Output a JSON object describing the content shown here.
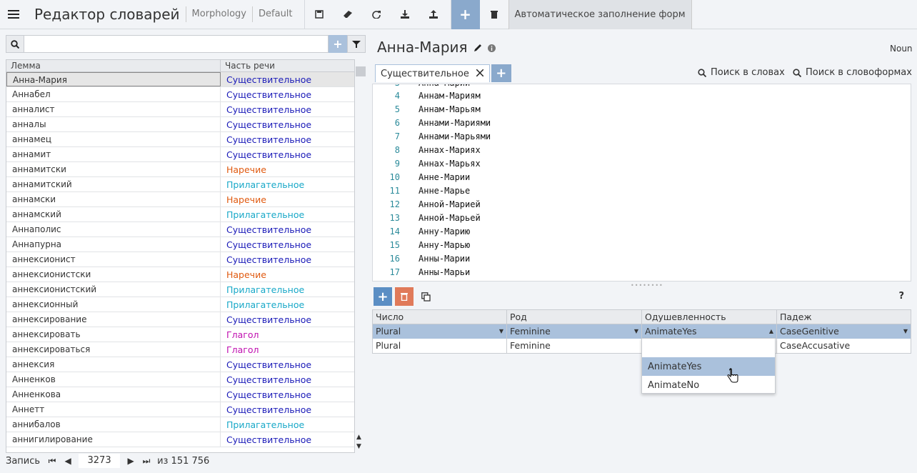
{
  "toolbar": {
    "title": "Редактор словарей",
    "link1": "Morphology",
    "link2": "Default",
    "autofill": "Автоматическое заполнение форм",
    "icons": [
      "menu-icon",
      "save-icon",
      "eraser-icon",
      "refresh-icon",
      "download-icon",
      "upload-icon",
      "plus-icon",
      "trash-icon"
    ]
  },
  "search": {
    "value": "",
    "placeholder": ""
  },
  "lemma_table": {
    "headers": [
      "Лемма",
      "Часть речи"
    ],
    "rows": [
      {
        "lemma": "Анна-Мария",
        "pos": "Существительное",
        "type": "noun"
      },
      {
        "lemma": "Аннабел",
        "pos": "Существительное",
        "type": "noun"
      },
      {
        "lemma": "анналист",
        "pos": "Существительное",
        "type": "noun"
      },
      {
        "lemma": "анналы",
        "pos": "Существительное",
        "type": "noun"
      },
      {
        "lemma": "аннамец",
        "pos": "Существительное",
        "type": "noun"
      },
      {
        "lemma": "аннамит",
        "pos": "Существительное",
        "type": "noun"
      },
      {
        "lemma": "аннамитски",
        "pos": "Наречие",
        "type": "adv"
      },
      {
        "lemma": "аннамитский",
        "pos": "Прилагательное",
        "type": "adj"
      },
      {
        "lemma": "аннамски",
        "pos": "Наречие",
        "type": "adv"
      },
      {
        "lemma": "аннамский",
        "pos": "Прилагательное",
        "type": "adj"
      },
      {
        "lemma": "Аннаполис",
        "pos": "Существительное",
        "type": "noun"
      },
      {
        "lemma": "Аннапурна",
        "pos": "Существительное",
        "type": "noun"
      },
      {
        "lemma": "аннексионист",
        "pos": "Существительное",
        "type": "noun"
      },
      {
        "lemma": "аннексионистски",
        "pos": "Наречие",
        "type": "adv"
      },
      {
        "lemma": "аннексионистский",
        "pos": "Прилагательное",
        "type": "adj"
      },
      {
        "lemma": "аннексионный",
        "pos": "Прилагательное",
        "type": "adj"
      },
      {
        "lemma": "аннексирование",
        "pos": "Существительное",
        "type": "noun"
      },
      {
        "lemma": "аннексировать",
        "pos": "Глагол",
        "type": "verb"
      },
      {
        "lemma": "аннексироваться",
        "pos": "Глагол",
        "type": "verb"
      },
      {
        "lemma": "аннексия",
        "pos": "Существительное",
        "type": "noun"
      },
      {
        "lemma": "Анненков",
        "pos": "Существительное",
        "type": "noun"
      },
      {
        "lemma": "Анненкова",
        "pos": "Существительное",
        "type": "noun"
      },
      {
        "lemma": "Аннетт",
        "pos": "Существительное",
        "type": "noun"
      },
      {
        "lemma": "аннибалов",
        "pos": "Прилагательное",
        "type": "adj"
      },
      {
        "lemma": "аннигилирование",
        "pos": "Существительное",
        "type": "noun"
      }
    ]
  },
  "pager": {
    "label": "Запись",
    "current": "3273",
    "total": "из 151 756"
  },
  "right": {
    "title": "Анна-Мария",
    "pos_code": "Noun",
    "tab": "Существительное",
    "search_words": "Поиск в словах",
    "search_forms": "Поиск в словоформах",
    "forms": [
      {
        "n": "4",
        "t": "Аннам-Мариям"
      },
      {
        "n": "5",
        "t": "Аннам-Марьям"
      },
      {
        "n": "6",
        "t": "Аннами-Мариями"
      },
      {
        "n": "7",
        "t": "Аннами-Марьями"
      },
      {
        "n": "8",
        "t": "Аннах-Мариях"
      },
      {
        "n": "9",
        "t": "Аннах-Марьях"
      },
      {
        "n": "10",
        "t": "Анне-Марии"
      },
      {
        "n": "11",
        "t": "Анне-Марье"
      },
      {
        "n": "12",
        "t": "Анной-Марией"
      },
      {
        "n": "13",
        "t": "Анной-Марьей"
      },
      {
        "n": "14",
        "t": "Анну-Марию"
      },
      {
        "n": "15",
        "t": "Анну-Марью"
      },
      {
        "n": "16",
        "t": "Анны-Марии"
      },
      {
        "n": "17",
        "t": "Анны-Марьи"
      }
    ],
    "grammemes": {
      "help": "?",
      "headers": [
        "Число",
        "Род",
        "Одушевленность",
        "Падеж"
      ],
      "rows": [
        [
          "Plural",
          "Feminine",
          "AnimateYes",
          "CaseGenitive"
        ],
        [
          "Plural",
          "Feminine",
          "",
          "CaseAccusative"
        ]
      ],
      "dropdown": [
        "",
        "AnimateYes",
        "AnimateNo"
      ]
    }
  }
}
